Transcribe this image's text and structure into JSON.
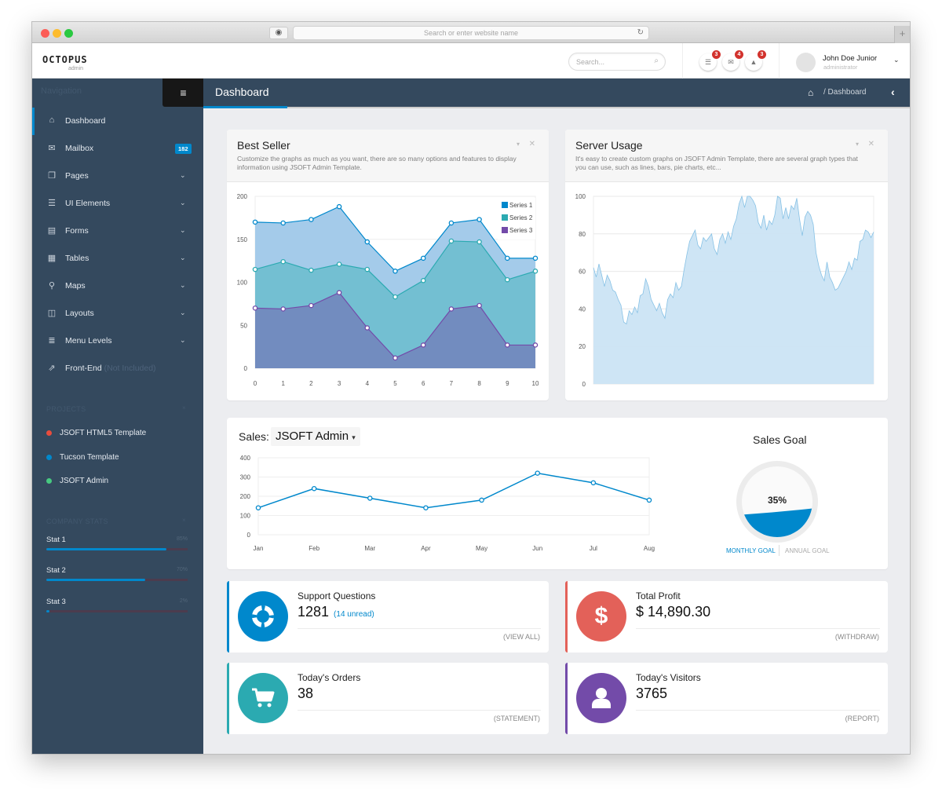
{
  "browser": {
    "url_placeholder": "Search or enter website name",
    "shield_icon": "◉",
    "reload_icon": "↻",
    "new_tab_icon": "+"
  },
  "header": {
    "logo": "OCTOPUS",
    "logo_sub": "admin",
    "search_placeholder": "Search...",
    "notifications": [
      {
        "icon": "tasks-icon",
        "glyph": "☰",
        "count": "3"
      },
      {
        "icon": "envelope-icon",
        "glyph": "✉",
        "count": "4"
      },
      {
        "icon": "bell-icon",
        "glyph": "🔔",
        "count": "3"
      }
    ],
    "user": {
      "name": "John Doe Junior",
      "role": "administrator",
      "chevron": "⌄"
    }
  },
  "sidebar": {
    "heading": "Navigation",
    "toggle_icon": "≡",
    "items": [
      {
        "label": "Dashboard",
        "icon": "⌂",
        "active": true
      },
      {
        "label": "Mailbox",
        "icon": "✉",
        "count": "182"
      },
      {
        "label": "Pages",
        "icon": "❐",
        "chevron": "⌄"
      },
      {
        "label": "UI Elements",
        "icon": "☰",
        "chevron": "⌄"
      },
      {
        "label": "Forms",
        "icon": "▤",
        "chevron": "⌄"
      },
      {
        "label": "Tables",
        "icon": "▦",
        "chevron": "⌄"
      },
      {
        "label": "Maps",
        "icon": "⚲",
        "chevron": "⌄"
      },
      {
        "label": "Layouts",
        "icon": "◫",
        "chevron": "⌄"
      },
      {
        "label": "Menu Levels",
        "icon": "≣",
        "chevron": "⌄"
      },
      {
        "label": "Front-End",
        "icon": "⇗",
        "note": "(Not Included)"
      }
    ],
    "projects": {
      "heading": "PROJECTS",
      "close": "×",
      "items": [
        {
          "label": "JSOFT HTML5 Template",
          "color": "#e84c3d"
        },
        {
          "label": "Tucson Template",
          "color": "#0088cc"
        },
        {
          "label": "JSOFT Admin",
          "color": "#47c980"
        }
      ]
    },
    "stats": {
      "heading": "COMPANY STATS",
      "close": "×",
      "items": [
        {
          "label": "Stat 1",
          "percent_label": "85%",
          "value": 85
        },
        {
          "label": "Stat 2",
          "percent_label": "70%",
          "value": 70
        },
        {
          "label": "Stat 3",
          "percent_label": "2%",
          "value": 2
        }
      ]
    }
  },
  "page": {
    "title": "Dashboard",
    "breadcrumb_home_icon": "⌂",
    "breadcrumb": "/  Dashboard",
    "back_icon": "‹"
  },
  "panels": {
    "best_seller": {
      "title": "Best Seller",
      "description": "Customize the graphs as much as you want, there are so many options and features to display information using JSOFT Admin Template.",
      "collapse_icon": "▾",
      "close_icon": "✕"
    },
    "server_usage": {
      "title": "Server Usage",
      "description": "It's easy to create custom graphs on JSOFT Admin Template, there are several graph types that you can use, such as lines, bars, pie charts, etc...",
      "collapse_icon": "▾",
      "close_icon": "✕"
    },
    "sales": {
      "label": "Sales:",
      "selected": "JSOFT Admin",
      "caret": "▾"
    },
    "sales_goal": {
      "title": "Sales Goal",
      "percent_label": "35%",
      "value": 35,
      "tabs": [
        "MONTHLY GOAL",
        "ANNUAL GOAL"
      ],
      "active_tab": "MONTHLY GOAL"
    }
  },
  "widgets": [
    {
      "title": "Support Questions",
      "value": "1281",
      "sub": "(14 unread)",
      "link": "(VIEW ALL)",
      "icon": "life-ring-icon",
      "glyph": "⊛",
      "color": "#0088cc"
    },
    {
      "title": "Total Profit",
      "value": "$ 14,890.30",
      "sub": "",
      "link": "(WITHDRAW)",
      "icon": "dollar-icon",
      "glyph": "$",
      "color": "#e36159"
    },
    {
      "title": "Today's Orders",
      "value": "38",
      "sub": "",
      "link": "(STATEMENT)",
      "icon": "shopping-cart-icon",
      "glyph": "🛒",
      "color": "#2baab1"
    },
    {
      "title": "Today's Visitors",
      "value": "3765",
      "sub": "",
      "link": "(REPORT)",
      "icon": "user-icon",
      "glyph": "👤",
      "color": "#734ba9"
    }
  ],
  "chart_data": [
    {
      "id": "best_seller",
      "type": "area",
      "stacked": true,
      "title": "Best Seller",
      "x": [
        0,
        1,
        2,
        3,
        4,
        5,
        6,
        7,
        8,
        9,
        10
      ],
      "ylim": [
        0,
        200
      ],
      "yticks": [
        0,
        50,
        100,
        150,
        200
      ],
      "grid": true,
      "legend": "top-right",
      "series_stacked_totals": [
        {
          "name": "Series 1",
          "color": "#0088cc",
          "fill": "#9fc8e9",
          "values": [
            170,
            169,
            173,
            188,
            147,
            113,
            128,
            169,
            173,
            128,
            128
          ]
        },
        {
          "name": "Series 2",
          "color": "#2baab1",
          "fill": "#6cbcd0",
          "values": [
            115,
            124,
            114,
            121,
            115,
            83,
            102,
            148,
            147,
            103,
            113
          ]
        },
        {
          "name": "Series 3",
          "color": "#734ba9",
          "fill": "#6a86bc",
          "values": [
            70,
            69,
            73,
            88,
            47,
            12,
            27,
            69,
            73,
            27,
            27
          ]
        }
      ]
    },
    {
      "id": "server_usage",
      "type": "area",
      "title": "Server Usage",
      "ylim": [
        0,
        100
      ],
      "yticks": [
        0,
        20,
        40,
        60,
        80,
        100
      ],
      "grid": true,
      "series": [
        {
          "name": "usage",
          "color": "#86c1e5",
          "fill": "#cbe4f4",
          "values": [
            62,
            57,
            64,
            58,
            52,
            58,
            55,
            50,
            49,
            45,
            42,
            33,
            32,
            39,
            37,
            41,
            38,
            47,
            48,
            56,
            52,
            45,
            42,
            39,
            43,
            38,
            35,
            45,
            48,
            46,
            54,
            50,
            52,
            61,
            69,
            76,
            79,
            82,
            74,
            72,
            78,
            76,
            78,
            80,
            72,
            69,
            77,
            80,
            75,
            81,
            77,
            84,
            88,
            96,
            100,
            94,
            100,
            100,
            98,
            95,
            86,
            83,
            90,
            82,
            87,
            85,
            90,
            100,
            99,
            88,
            94,
            88,
            95,
            93,
            99,
            88,
            79,
            89,
            92,
            90,
            85,
            70,
            63,
            58,
            55,
            65,
            57,
            54,
            50,
            51,
            54,
            57,
            60,
            65,
            61,
            67,
            66,
            76,
            77,
            82,
            81,
            78,
            81
          ]
        }
      ]
    },
    {
      "id": "sales",
      "type": "line",
      "title": "Sales: JSOFT Admin",
      "categories": [
        "Jan",
        "Feb",
        "Mar",
        "Apr",
        "May",
        "Jun",
        "Jul",
        "Aug"
      ],
      "ylim": [
        0,
        400
      ],
      "yticks": [
        0,
        100,
        200,
        300,
        400
      ],
      "grid": true,
      "series": [
        {
          "name": "JSOFT Admin",
          "color": "#0088cc",
          "values": [
            140,
            240,
            190,
            140,
            180,
            320,
            270,
            180
          ]
        }
      ]
    }
  ]
}
